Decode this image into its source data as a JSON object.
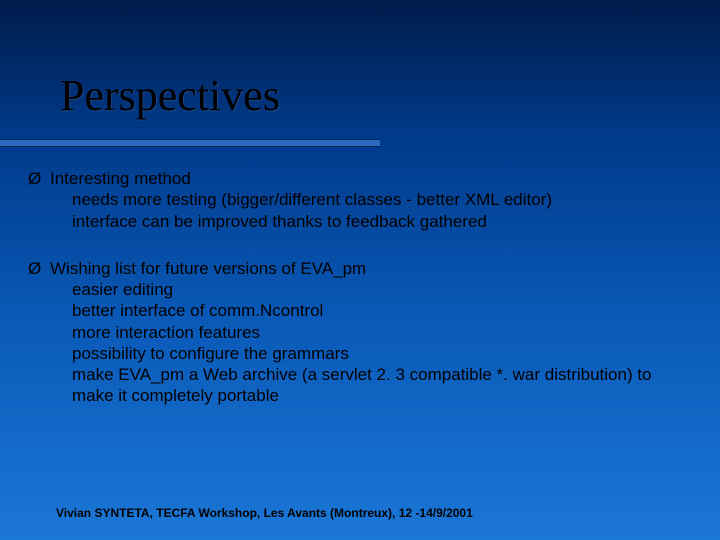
{
  "slide": {
    "title": "Perspectives",
    "bullets": [
      {
        "head": "Interesting method",
        "subs": [
          "needs more testing (bigger/different classes - better XML editor)",
          "interface can be improved thanks to feedback gathered"
        ]
      },
      {
        "head": "Wishing list for future versions of EVA_pm",
        "subs": [
          "easier editing",
          "better interface of comm.Ncontrol",
          "more interaction features",
          "possibility to configure the grammars",
          "make EVA_pm a Web archive (a servlet 2. 3 compatible *. war distribution) to make it completely portable"
        ]
      }
    ],
    "footer": "Vivian SYNTETA, TECFA Workshop, Les Avants (Montreux), 12 -14/9/2001",
    "bullet_glyph": "Ø"
  }
}
